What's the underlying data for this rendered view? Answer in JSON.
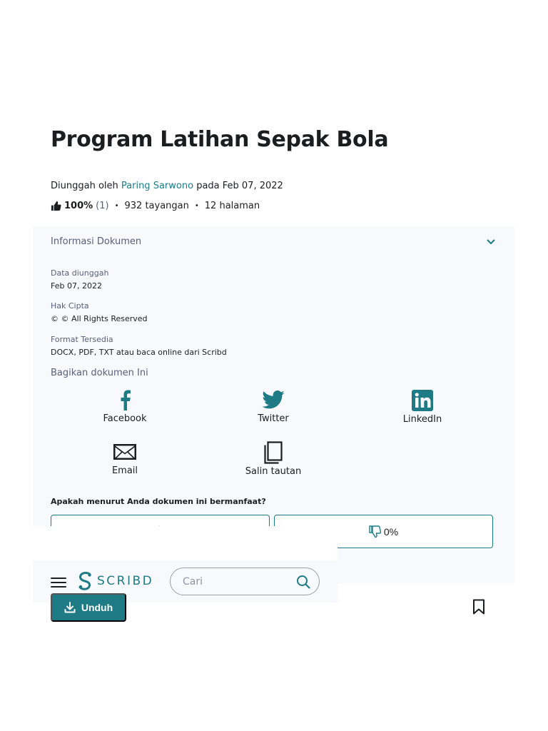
{
  "document": {
    "title": "Program Latihan Sepak Bola",
    "uploaded_prefix": "Diunggah oleh",
    "author": "Paring Sarwono",
    "uploaded_mid": "pada",
    "upload_date": "Feb 07, 2022",
    "rating_percent": "100%",
    "rating_count": "(1)",
    "views": "932 tayangan",
    "pages": "12 halaman",
    "separator": "•"
  },
  "info": {
    "header": "Informasi Dokumen",
    "fields": [
      {
        "label": "Data diunggah",
        "value": "Feb 07, 2022"
      },
      {
        "label": "Hak Cipta",
        "value": "© © All Rights Reserved"
      },
      {
        "label": "Format Tersedia",
        "value": "DOCX, PDF, TXT atau baca online dari Scribd"
      }
    ]
  },
  "share": {
    "heading": "Bagikan dokumen Ini",
    "items": [
      {
        "label": "Facebook",
        "icon": "facebook-icon"
      },
      {
        "label": "Twitter",
        "icon": "twitter-icon"
      },
      {
        "label": "LinkedIn",
        "icon": "linkedin-icon"
      },
      {
        "label": "Email",
        "icon": "email-icon"
      },
      {
        "label": "Salin tautan",
        "icon": "copy-icon"
      }
    ]
  },
  "feedback": {
    "question": "Apakah menurut Anda dokumen ini bermanfaat?",
    "dislike_percent": "0%"
  },
  "nav": {
    "logo_text": "SCRIBD",
    "search_placeholder": "Cari"
  },
  "actions": {
    "download_label": "Unduh"
  },
  "colors": {
    "accent": "#1e7b85",
    "panel_bg": "#f8f9fd",
    "text": "#1c1d1f",
    "muted": "#57617a"
  }
}
